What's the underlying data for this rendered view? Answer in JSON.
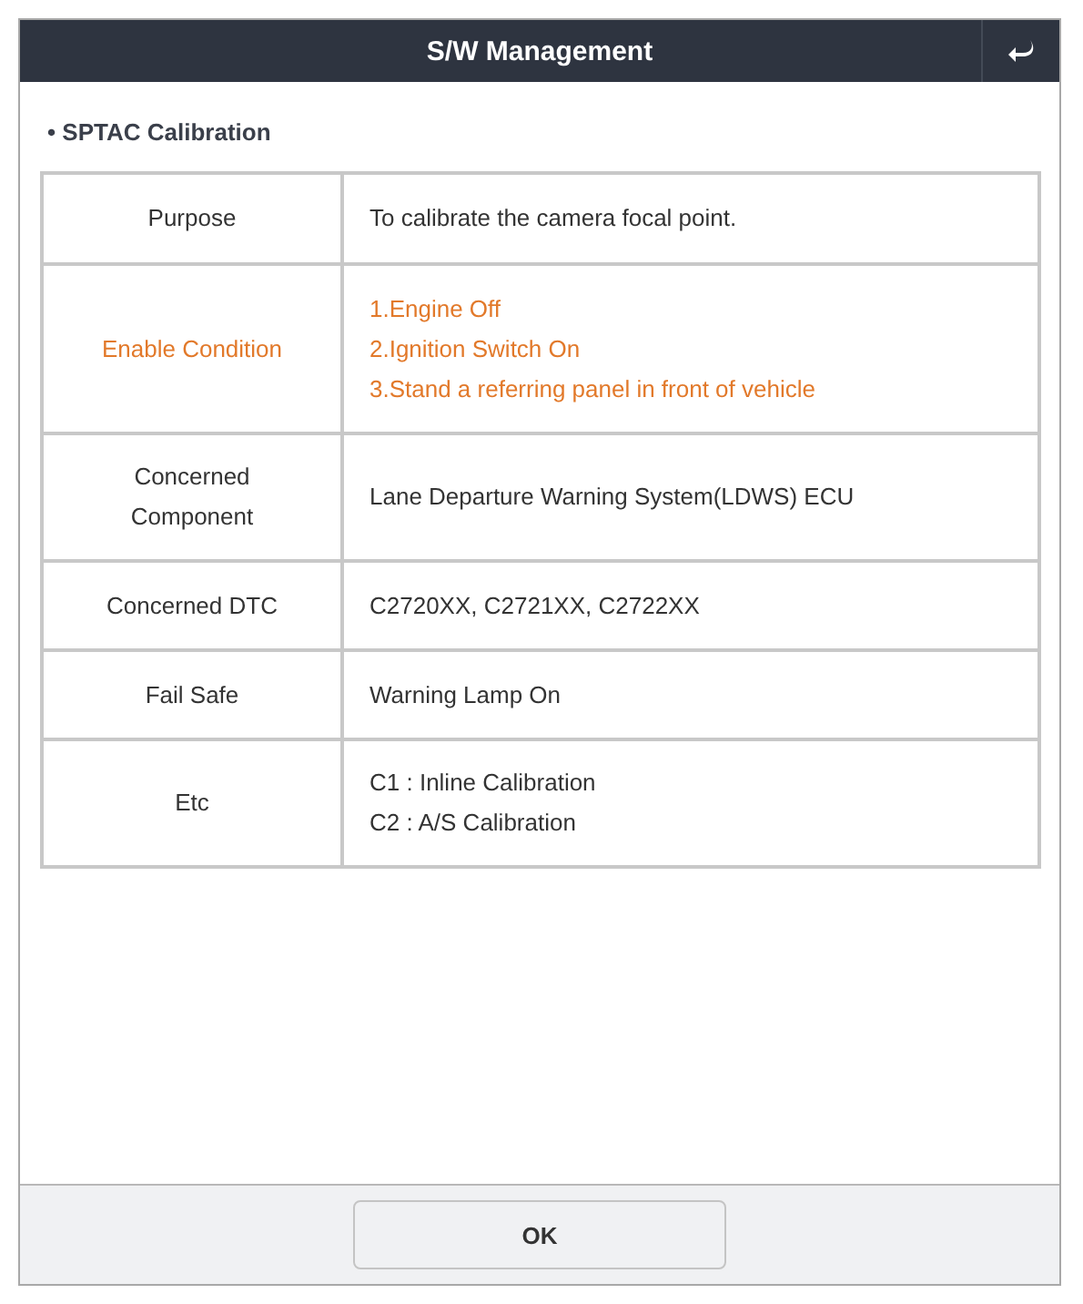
{
  "window": {
    "title": "S/W Management"
  },
  "section_title": "• SPTAC Calibration",
  "table": {
    "rows": [
      {
        "label": [
          "Purpose"
        ],
        "lines": [
          "To calibrate the camera focal point."
        ],
        "highlighted": false
      },
      {
        "label": [
          "Enable Condition"
        ],
        "lines": [
          "1.Engine Off",
          "2.Ignition Switch On",
          "3.Stand a referring panel in front of vehicle"
        ],
        "highlighted": true
      },
      {
        "label": [
          "Concerned",
          "Component"
        ],
        "lines": [
          "Lane Departure Warning System(LDWS) ECU"
        ],
        "highlighted": false
      },
      {
        "label": [
          "Concerned DTC"
        ],
        "lines": [
          "C2720XX, C2721XX, C2722XX"
        ],
        "highlighted": false
      },
      {
        "label": [
          "Fail Safe"
        ],
        "lines": [
          "Warning Lamp On"
        ],
        "highlighted": false
      },
      {
        "label": [
          "Etc"
        ],
        "lines": [
          "C1 : Inline Calibration",
          "C2 : A/S Calibration"
        ],
        "highlighted": false
      }
    ]
  },
  "buttons": [
    {
      "label": "OK"
    }
  ]
}
